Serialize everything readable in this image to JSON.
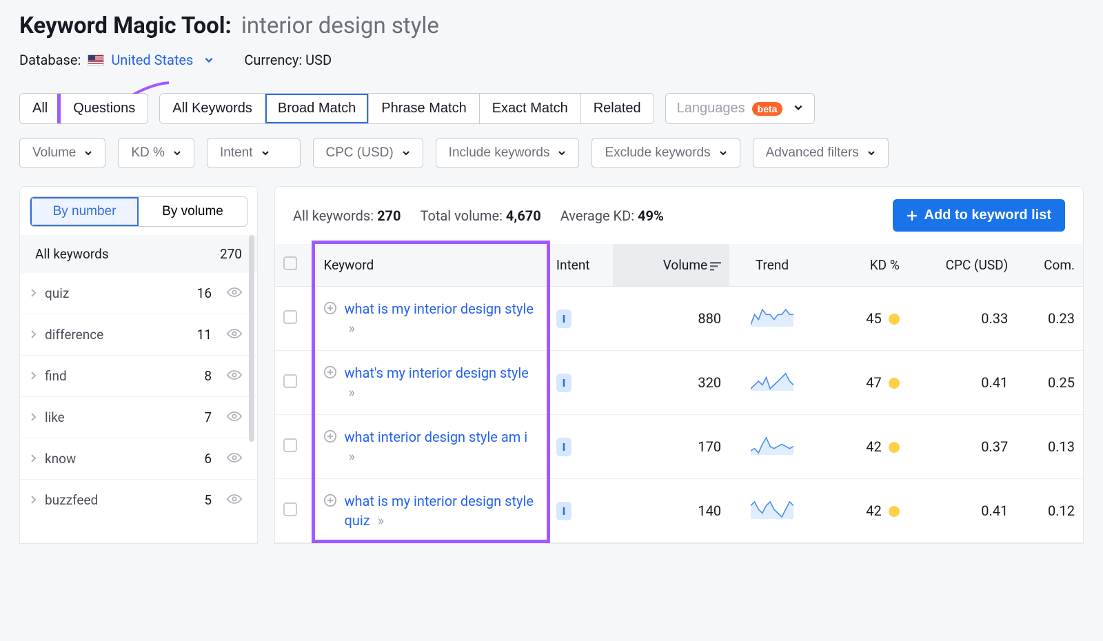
{
  "title": {
    "tool": "Keyword Magic Tool:",
    "query": "interior design style"
  },
  "meta": {
    "database_label": "Database:",
    "country": "United States",
    "currency_label": "Currency:",
    "currency_value": "USD"
  },
  "scope_tabs": {
    "all": "All",
    "questions": "Questions"
  },
  "match_tabs": {
    "all_kw": "All Keywords",
    "broad": "Broad Match",
    "phrase": "Phrase Match",
    "exact": "Exact Match",
    "related": "Related"
  },
  "languages_btn": {
    "label": "Languages",
    "badge": "beta"
  },
  "filters": {
    "volume": "Volume",
    "kd": "KD %",
    "intent": "Intent",
    "cpc": "CPC (USD)",
    "include": "Include keywords",
    "exclude": "Exclude keywords",
    "advanced": "Advanced filters"
  },
  "sidebar": {
    "by_number": "By number",
    "by_volume": "By volume",
    "header_label": "All keywords",
    "header_count": "270",
    "items": [
      {
        "label": "quiz",
        "count": "16"
      },
      {
        "label": "difference",
        "count": "11"
      },
      {
        "label": "find",
        "count": "8"
      },
      {
        "label": "like",
        "count": "7"
      },
      {
        "label": "know",
        "count": "6"
      },
      {
        "label": "buzzfeed",
        "count": "5"
      }
    ]
  },
  "summary": {
    "all_kw_label": "All keywords:",
    "all_kw_value": "270",
    "total_vol_label": "Total volume:",
    "total_vol_value": "4,670",
    "avg_kd_label": "Average KD:",
    "avg_kd_value": "49%",
    "add_btn": "Add to keyword list"
  },
  "columns": {
    "keyword": "Keyword",
    "intent": "Intent",
    "volume": "Volume",
    "trend": "Trend",
    "kd": "KD %",
    "cpc": "CPC (USD)",
    "com": "Com."
  },
  "rows": [
    {
      "kw": "what is my interior design style",
      "intent": "I",
      "volume": "880",
      "kd": "45",
      "cpc": "0.33",
      "com": "0.23",
      "trend": "8,10,9,11,10,10,9,10,10,11,10,10"
    },
    {
      "kw": "what's my interior design style",
      "intent": "I",
      "volume": "320",
      "kd": "47",
      "cpc": "0.41",
      "com": "0.25",
      "trend": "7,8,9,8,10,7,8,9,10,11,9,8"
    },
    {
      "kw": "what interior design style am i",
      "intent": "I",
      "volume": "170",
      "kd": "42",
      "cpc": "0.37",
      "com": "0.13",
      "trend": "6,7,5,9,12,8,7,8,9,8,7,8"
    },
    {
      "kw": "what is my interior design style quiz",
      "intent": "I",
      "volume": "140",
      "kd": "42",
      "cpc": "0.41",
      "com": "0.12",
      "trend": "9,10,8,7,9,10,8,7,6,8,10,9"
    }
  ]
}
